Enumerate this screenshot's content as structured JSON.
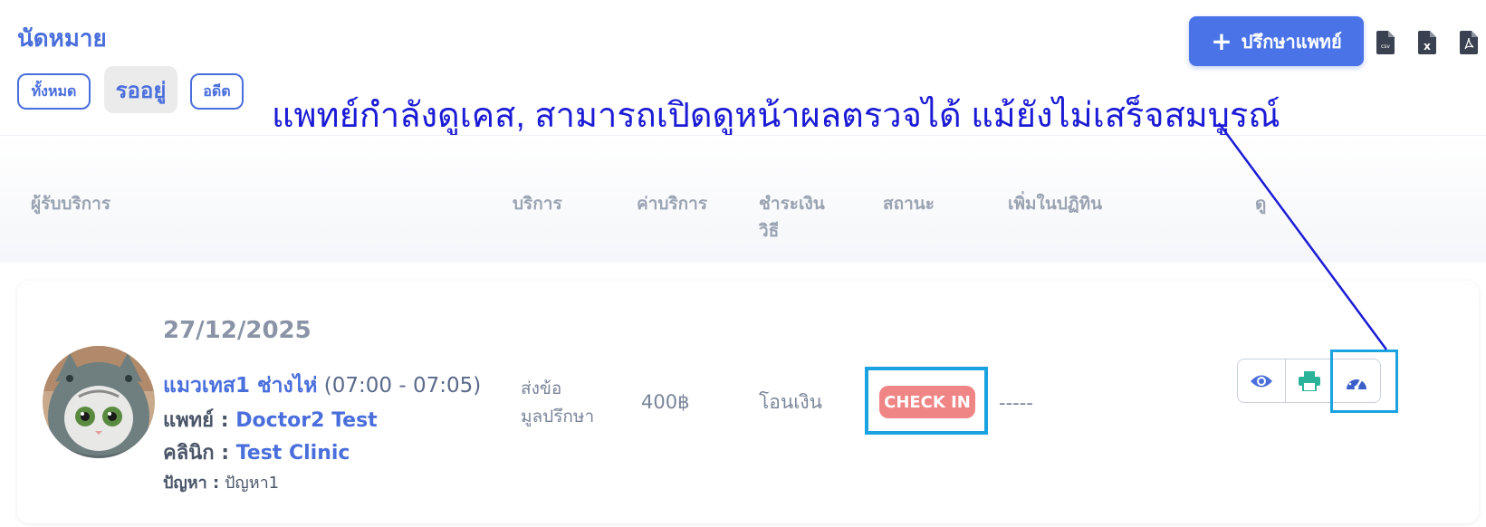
{
  "header": {
    "title": "นัดหมาย",
    "filters": [
      {
        "label": "ทั้งหมด",
        "active": false
      },
      {
        "label": "รออยู่",
        "active": true
      },
      {
        "label": "อดีต",
        "active": false
      }
    ],
    "consult_button": "ปรึกษาแพทย์",
    "export_icons": [
      "csv-file-icon",
      "excel-file-icon",
      "pdf-file-icon"
    ],
    "csv_label": "csv",
    "excel_label": "x"
  },
  "annotation": {
    "text": "แพทย์กำลังดูเคส, สามารถเปิดดูหน้าผลตรวจได้ แม้ยังไม่เสร็จสมบูรณ์",
    "color": "#1b1bd6"
  },
  "table": {
    "columns": [
      "ผู้รับบริการ",
      "บริการ",
      "ค่าบริการ",
      "ชำระเงิน",
      "วิธี",
      "สถานะ",
      "เพิ่มในปฏิทิน",
      "ดู"
    ],
    "rows": [
      {
        "date": "27/12/2025",
        "patient_name": "แมวเทส1 ช่างไห่",
        "time_range": "(07:00 - 07:05)",
        "doctor_label": "แพทย์ :",
        "doctor": "Doctor2 Test",
        "clinic_label": "คลินิก :",
        "clinic": "Test Clinic",
        "problem_label": "ปัญหา :",
        "problem": "ปัญหา1",
        "service_line1": "ส่งข้อ",
        "service_line2": "มูลปรึกษา",
        "price": "400฿",
        "payment": "โอนเงิน",
        "status": "CHECK IN",
        "calendar": "-----",
        "actions": [
          "eye-icon",
          "printer-icon",
          "dashboard-gauge-icon"
        ]
      }
    ]
  },
  "colors": {
    "primary": "#4a6fdc",
    "button": "#4a73e8",
    "status_badge": "#f08585",
    "highlight": "#1aa3e0",
    "print_icon": "#2bb39a"
  }
}
